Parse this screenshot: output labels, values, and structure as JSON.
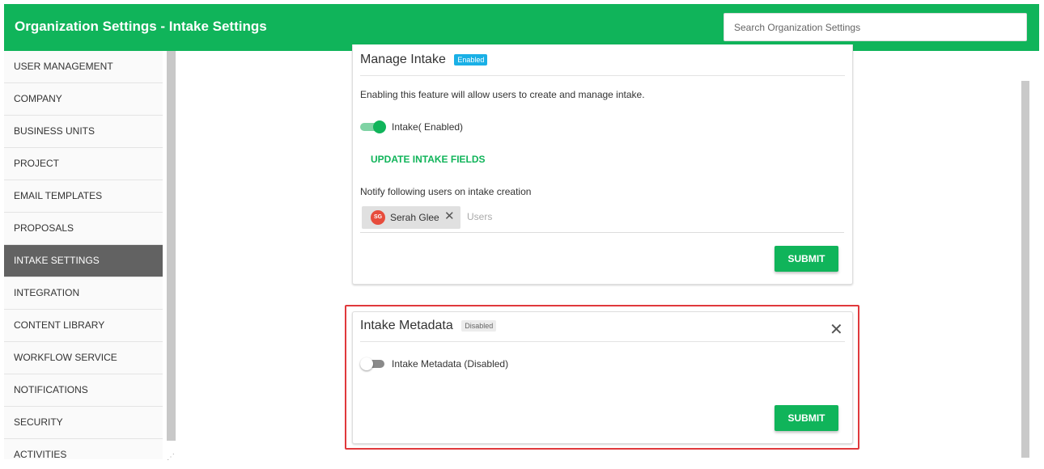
{
  "header": {
    "title": "Organization Settings - Intake Settings",
    "search_placeholder": "Search Organization Settings"
  },
  "sidebar": {
    "items": [
      {
        "label": "USER MANAGEMENT"
      },
      {
        "label": "COMPANY"
      },
      {
        "label": "BUSINESS UNITS"
      },
      {
        "label": "PROJECT"
      },
      {
        "label": "EMAIL TEMPLATES"
      },
      {
        "label": "PROPOSALS"
      },
      {
        "label": "INTAKE SETTINGS",
        "active": true
      },
      {
        "label": "INTEGRATION"
      },
      {
        "label": "CONTENT LIBRARY"
      },
      {
        "label": "WORKFLOW SERVICE"
      },
      {
        "label": "NOTIFICATIONS"
      },
      {
        "label": "SECURITY"
      },
      {
        "label": "ACTIVITIES"
      }
    ]
  },
  "manage_intake": {
    "title": "Manage Intake",
    "badge": "Enabled",
    "description": "Enabling this feature will allow users to create and manage intake.",
    "toggle_label": "Intake( Enabled)",
    "toggle_on": true,
    "update_fields_label": "UPDATE INTAKE FIELDS",
    "notify_label": "Notify following users on intake creation",
    "chip": {
      "initials": "SG",
      "name": "Serah Glee",
      "remove_icon": "close-icon"
    },
    "users_placeholder": "Users",
    "submit_label": "SUBMIT"
  },
  "intake_metadata": {
    "title": "Intake Metadata",
    "badge": "Disabled",
    "toggle_label": "Intake Metadata (Disabled)",
    "toggle_on": false,
    "submit_label": "SUBMIT",
    "close_icon": "close-icon"
  },
  "colors": {
    "brand_green": "#10b45a",
    "enabled_badge": "#1ab0e6",
    "highlight_border": "#e0393c",
    "avatar": "#e74c3c",
    "active_nav": "#626262"
  }
}
